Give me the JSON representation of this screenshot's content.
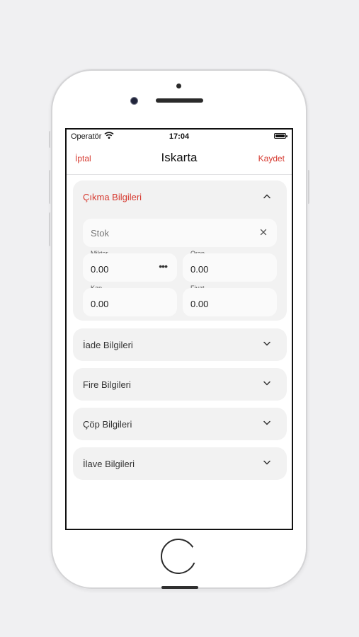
{
  "status_bar": {
    "carrier": "Operatör",
    "time": "17:04"
  },
  "nav": {
    "cancel_label": "İptal",
    "title": "Iskarta",
    "save_label": "Kaydet"
  },
  "colors": {
    "accent": "#d63a30",
    "card_bg": "#f2f2f2",
    "field_bg": "#fafafa"
  },
  "sections": [
    {
      "title": "Çıkma Bilgileri",
      "expanded": true,
      "stok_placeholder": "Stok",
      "fields": [
        {
          "label": "Miktar",
          "value": "0.00"
        },
        {
          "label": "Oran",
          "value": "0.00"
        },
        {
          "label": "Kap",
          "value": "0.00"
        },
        {
          "label": "Fiyat",
          "value": "0.00"
        }
      ]
    },
    {
      "title": "İade Bilgileri",
      "expanded": false
    },
    {
      "title": "Fire Bilgileri",
      "expanded": false
    },
    {
      "title": "Çöp Bilgileri",
      "expanded": false
    },
    {
      "title": "İlave Bilgileri",
      "expanded": false
    }
  ],
  "icons": {
    "wifi": "wifi-icon",
    "battery": "battery-icon",
    "collapse": "chevron-up-icon",
    "expand": "chevron-down-icon",
    "clear": "close-icon",
    "more": "more-horizontal-icon"
  }
}
